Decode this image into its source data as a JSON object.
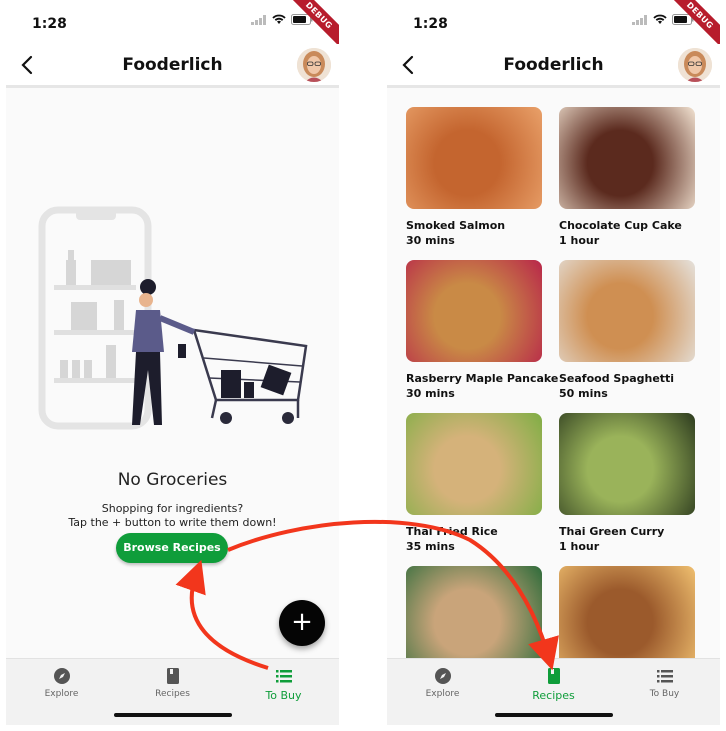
{
  "left": {
    "status_time": "1:28",
    "debug": "DEBUG",
    "app_title": "Fooderlich",
    "empty_title": "No Groceries",
    "empty_line1": "Shopping for ingredients?",
    "empty_line2": "Tap the + button to write them down!",
    "browse_label": "Browse Recipes",
    "fab_label": "+",
    "nav": [
      {
        "label": "Explore",
        "icon": "compass-icon"
      },
      {
        "label": "Recipes",
        "icon": "book-icon"
      },
      {
        "label": "To Buy",
        "icon": "list-icon"
      }
    ],
    "active_tab": "To Buy"
  },
  "right": {
    "status_time": "1:28",
    "debug": "DEBUG",
    "app_title": "Fooderlich",
    "recipes": [
      {
        "name": "Smoked Salmon",
        "time": "30 mins",
        "colors": [
          "#c4652f",
          "#e9a16a"
        ]
      },
      {
        "name": "Chocolate Cup Cake",
        "time": "1 hour",
        "colors": [
          "#5b2a1e",
          "#f2e3d2"
        ]
      },
      {
        "name": "Rasberry Maple Pancake",
        "time": "30 mins",
        "colors": [
          "#c98a46",
          "#b8264a"
        ]
      },
      {
        "name": "Seafood Spaghetti",
        "time": "50 mins",
        "colors": [
          "#cf8f52",
          "#e5e2dd"
        ]
      },
      {
        "name": "Thai Fried Rice",
        "time": "35 mins",
        "colors": [
          "#d5b27a",
          "#7fae44"
        ]
      },
      {
        "name": "Thai Green Curry",
        "time": "1 hour",
        "colors": [
          "#9ab35a",
          "#2c3a1e"
        ]
      },
      {
        "name": "",
        "time": "",
        "colors": [
          "#c9a47a",
          "#2d6b3a"
        ]
      },
      {
        "name": "",
        "time": "",
        "colors": [
          "#9b5a2c",
          "#f0c070"
        ]
      }
    ],
    "nav": [
      {
        "label": "Explore",
        "icon": "compass-icon"
      },
      {
        "label": "Recipes",
        "icon": "book-icon"
      },
      {
        "label": "To Buy",
        "icon": "list-icon"
      }
    ],
    "active_tab": "Recipes"
  },
  "colors": {
    "accent": "#0f9d3a",
    "arrow": "#f2361c",
    "debug_banner": "#b71c2c"
  }
}
